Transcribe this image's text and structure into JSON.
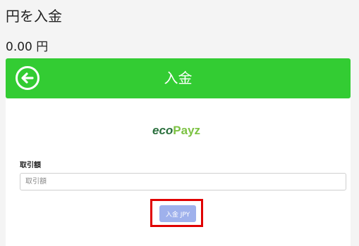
{
  "page": {
    "title": "円を入金",
    "balance": "0.00 円"
  },
  "header": {
    "title": "入金",
    "back_icon": "arrow-left-circle-icon"
  },
  "form": {
    "logo_part1": "eco",
    "logo_part2": "Payz",
    "amount_label": "取引額",
    "amount_placeholder": "取引額",
    "amount_value": "",
    "submit_label": "入金 JPY"
  },
  "colors": {
    "header_bg": "#33cc33",
    "button_bg": "#9fb1ec",
    "highlight": "#e00000"
  }
}
